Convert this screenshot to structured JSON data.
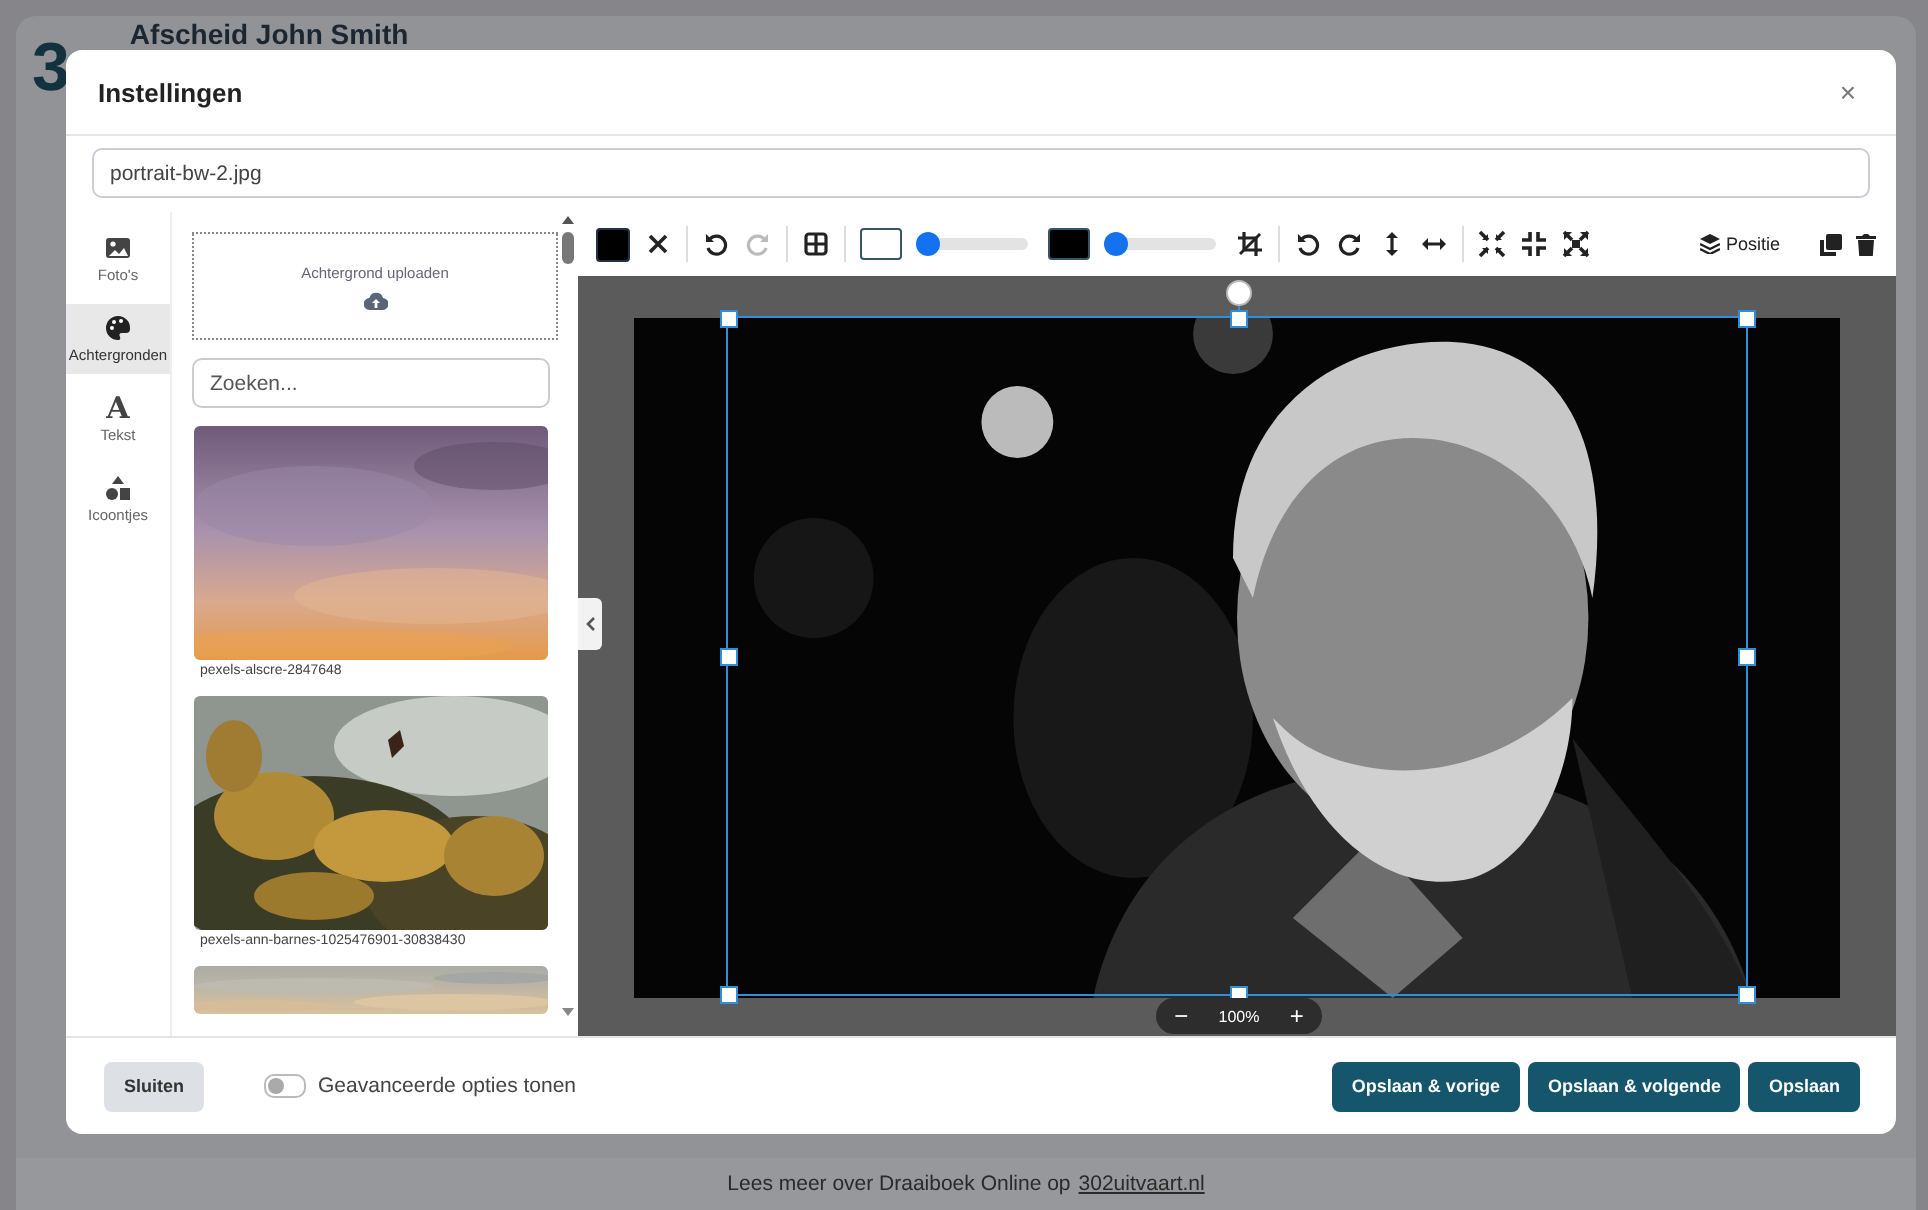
{
  "background_page": {
    "logo": "3",
    "title": "Afscheid John Smith",
    "footer_text": "Lees meer over Draaiboek Online op",
    "footer_link": "302uitvaart.nl"
  },
  "dialog": {
    "title": "Instellingen",
    "close": "×",
    "filename": "portrait-bw-2.jpg"
  },
  "sidebar": {
    "items": [
      {
        "kind": "photos",
        "label": "Foto's",
        "selected": false
      },
      {
        "kind": "backgrounds",
        "label": "Achtergronden",
        "selected": true
      },
      {
        "kind": "text",
        "glyph": "A",
        "label": "Tekst",
        "selected": false
      },
      {
        "kind": "icons",
        "label": "Icoontjes",
        "selected": false
      }
    ]
  },
  "panel": {
    "upload_label": "Achtergrond uploaden",
    "search_placeholder": "Zoeken...",
    "images": [
      {
        "kind": "sunset",
        "caption": "pexels-alscre-2847648"
      },
      {
        "kind": "flowers",
        "caption": "pexels-ann-barnes-1025476901-30838430"
      },
      {
        "kind": "sky"
      }
    ]
  },
  "toolbar": {
    "items": [
      {
        "kind": "swatch",
        "color": "#000000"
      },
      {
        "kind": "clear",
        "disabled": false
      },
      {
        "kind": "divider"
      },
      {
        "kind": "undo",
        "disabled": false
      },
      {
        "kind": "redo",
        "disabled": true
      },
      {
        "kind": "divider"
      },
      {
        "kind": "grid",
        "disabled": false
      },
      {
        "kind": "divider"
      },
      {
        "kind": "swatch",
        "color": "#ffffff"
      },
      {
        "kind": "slider",
        "level": 0.05
      },
      {
        "kind": "swatch",
        "color": "#000000"
      },
      {
        "kind": "slider",
        "level": 0.05
      },
      {
        "kind": "crop",
        "disabled": false
      },
      {
        "kind": "divider"
      },
      {
        "kind": "rotate-left",
        "disabled": false
      },
      {
        "kind": "rotate-right",
        "disabled": false
      },
      {
        "kind": "flip-vertical",
        "disabled": false
      },
      {
        "kind": "flip-horizontal",
        "disabled": false
      },
      {
        "kind": "divider"
      },
      {
        "kind": "compress",
        "disabled": false
      },
      {
        "kind": "shrink",
        "disabled": false
      },
      {
        "kind": "expand",
        "disabled": false
      }
    ],
    "position_label": "Positie"
  },
  "zoom": {
    "minus": "−",
    "value": "100%",
    "plus": "+"
  },
  "footer": {
    "close": "Sluiten",
    "advanced_toggle": {
      "label": "Geavanceerde opties tonen",
      "on": false
    },
    "buttons": [
      "Opslaan & vorige",
      "Opslaan & volgende",
      "Opslaan"
    ]
  }
}
